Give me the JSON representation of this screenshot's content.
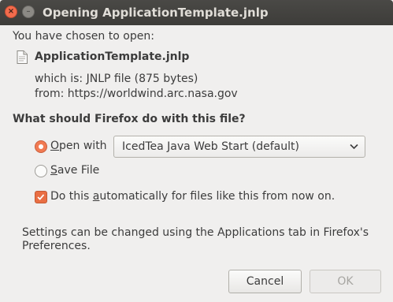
{
  "window": {
    "title": "Opening ApplicationTemplate.jnlp",
    "close_glyph": "×",
    "minimize_glyph": "–"
  },
  "dialog": {
    "intro": "You have chosen to open:",
    "file_name": "ApplicationTemplate.jnlp",
    "which_is_label": "which is:",
    "which_is_value": "JNLP file (875 bytes)",
    "from_label": "from:",
    "from_value": "https://worldwind.arc.nasa.gov",
    "question": "What should Firefox do with this file?",
    "open_with": {
      "mnemonic": "O",
      "label_rest": "pen with",
      "selected": true,
      "app": "IcedTea Java Web Start (default)"
    },
    "save_file": {
      "mnemonic": "S",
      "label_rest": "ave File",
      "selected": false
    },
    "auto_checkbox": {
      "prefix": "Do this ",
      "mnemonic": "a",
      "suffix": "utomatically for files like this from now on.",
      "checked": true
    },
    "settings_note_line1": "Settings can be changed using the Applications tab in Firefox's",
    "settings_note_line2": "Preferences.",
    "buttons": {
      "cancel": "Cancel",
      "ok": "OK"
    }
  },
  "colors": {
    "accent": "#e96e43",
    "titlebar": "#403f3c",
    "background": "#f0efee"
  }
}
